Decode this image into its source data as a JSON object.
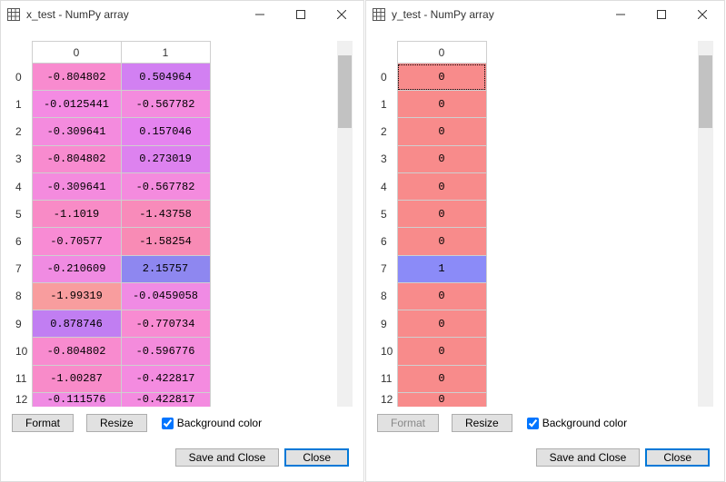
{
  "windows": [
    {
      "title": "x_test - NumPy array",
      "columns": [
        "0",
        "1"
      ],
      "rows": [
        {
          "idx": "0",
          "cells": [
            "-0.804802",
            "0.504964"
          ],
          "colors": [
            "#f88bcf",
            "#d280f2"
          ]
        },
        {
          "idx": "1",
          "cells": [
            "-0.0125441",
            "-0.567782"
          ],
          "colors": [
            "#f48be3",
            "#f48bde"
          ]
        },
        {
          "idx": "2",
          "cells": [
            "-0.309641",
            "0.157046"
          ],
          "colors": [
            "#f48bde",
            "#e583ef"
          ]
        },
        {
          "idx": "3",
          "cells": [
            "-0.804802",
            "0.273019"
          ],
          "colors": [
            "#f88bcf",
            "#dd82ef"
          ]
        },
        {
          "idx": "4",
          "cells": [
            "-0.309641",
            "-0.567782"
          ],
          "colors": [
            "#f48bde",
            "#f48bde"
          ]
        },
        {
          "idx": "5",
          "cells": [
            "-1.1019",
            "-1.43758"
          ],
          "colors": [
            "#f88bc6",
            "#f88bba"
          ]
        },
        {
          "idx": "6",
          "cells": [
            "-0.70577",
            "-1.58254"
          ],
          "colors": [
            "#f88bd4",
            "#f88bb5"
          ]
        },
        {
          "idx": "7",
          "cells": [
            "-0.210609",
            "2.15757"
          ],
          "colors": [
            "#f08be2",
            "#8e87f0"
          ]
        },
        {
          "idx": "8",
          "cells": [
            "-1.99319",
            "-0.0459058"
          ],
          "colors": [
            "#f89d9e",
            "#f08be4"
          ]
        },
        {
          "idx": "9",
          "cells": [
            "0.878746",
            "-0.770734"
          ],
          "colors": [
            "#c17ef2",
            "#f88bd2"
          ]
        },
        {
          "idx": "10",
          "cells": [
            "-0.804802",
            "-0.596776"
          ],
          "colors": [
            "#f88bcf",
            "#f48bdc"
          ]
        },
        {
          "idx": "11",
          "cells": [
            "-1.00287",
            "-0.422817"
          ],
          "colors": [
            "#f88bc9",
            "#f48be0"
          ]
        },
        {
          "idx": "12",
          "cells": [
            "-0.111576",
            "-0.422817"
          ],
          "colors": [
            "#f08be3",
            "#f48be0"
          ]
        }
      ],
      "bg_checked": true,
      "btn_format": "Format",
      "btn_resize": "Resize",
      "cbx_bg": "Background color",
      "btn_saveclose": "Save and Close",
      "btn_close": "Close",
      "format_disabled": false
    },
    {
      "title": "y_test - NumPy array",
      "columns": [
        "0"
      ],
      "rows": [
        {
          "idx": "0",
          "cells": [
            "0"
          ],
          "colors": [
            "#f88b8b"
          ],
          "selected": true
        },
        {
          "idx": "1",
          "cells": [
            "0"
          ],
          "colors": [
            "#f88b8b"
          ]
        },
        {
          "idx": "2",
          "cells": [
            "0"
          ],
          "colors": [
            "#f88b8b"
          ]
        },
        {
          "idx": "3",
          "cells": [
            "0"
          ],
          "colors": [
            "#f88b8b"
          ]
        },
        {
          "idx": "4",
          "cells": [
            "0"
          ],
          "colors": [
            "#f88b8b"
          ]
        },
        {
          "idx": "5",
          "cells": [
            "0"
          ],
          "colors": [
            "#f88b8b"
          ]
        },
        {
          "idx": "6",
          "cells": [
            "0"
          ],
          "colors": [
            "#f88b8b"
          ]
        },
        {
          "idx": "7",
          "cells": [
            "1"
          ],
          "colors": [
            "#8b8bf8"
          ]
        },
        {
          "idx": "8",
          "cells": [
            "0"
          ],
          "colors": [
            "#f88b8b"
          ]
        },
        {
          "idx": "9",
          "cells": [
            "0"
          ],
          "colors": [
            "#f88b8b"
          ]
        },
        {
          "idx": "10",
          "cells": [
            "0"
          ],
          "colors": [
            "#f88b8b"
          ]
        },
        {
          "idx": "11",
          "cells": [
            "0"
          ],
          "colors": [
            "#f88b8b"
          ]
        },
        {
          "idx": "12",
          "cells": [
            "0"
          ],
          "colors": [
            "#f88b8b"
          ]
        }
      ],
      "bg_checked": true,
      "btn_format": "Format",
      "btn_resize": "Resize",
      "cbx_bg": "Background color",
      "btn_saveclose": "Save and Close",
      "btn_close": "Close",
      "format_disabled": true
    }
  ]
}
